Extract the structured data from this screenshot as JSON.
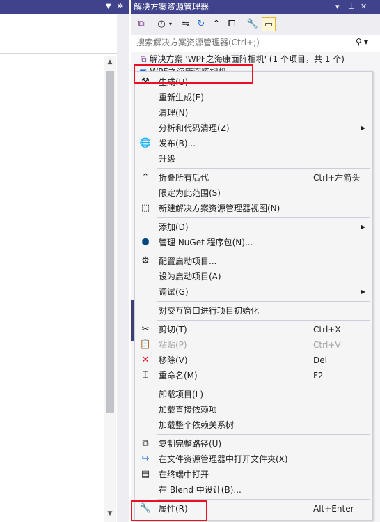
{
  "se": {
    "title": "解决方案资源管理器",
    "search_placeholder": "搜索解决方案资源管理器(Ctrl+;)",
    "solution_label": "解决方案 'WPF之海康面阵相机' (1 个项目，共 1 个)",
    "project_label": "WPF之海康面阵相机"
  },
  "menu": [
    {
      "id": "build",
      "icon": "build-icon",
      "glyph": "⚒",
      "label": "生成(U)",
      "shortcut": "",
      "submenu": false,
      "disabled": false
    },
    {
      "id": "rebuild",
      "icon": "",
      "glyph": "",
      "label": "重新生成(E)",
      "shortcut": "",
      "submenu": false,
      "disabled": false
    },
    {
      "id": "clean",
      "icon": "",
      "glyph": "",
      "label": "清理(N)",
      "shortcut": "",
      "submenu": false,
      "disabled": false
    },
    {
      "id": "analyze",
      "icon": "",
      "glyph": "",
      "label": "分析和代码清理(Z)",
      "shortcut": "",
      "submenu": true,
      "disabled": false
    },
    {
      "id": "publish",
      "icon": "globe-icon",
      "glyph": "🌐",
      "label": "发布(B)...",
      "shortcut": "",
      "submenu": false,
      "disabled": false
    },
    {
      "id": "upgrade",
      "icon": "",
      "glyph": "",
      "label": "升级",
      "shortcut": "",
      "submenu": false,
      "disabled": false
    },
    {
      "id": "collapse",
      "icon": "collapse-icon",
      "glyph": "⌃",
      "label": "折叠所有后代",
      "shortcut": "Ctrl+左箭头",
      "submenu": false,
      "disabled": false
    },
    {
      "id": "scope",
      "icon": "",
      "glyph": "",
      "label": "限定为此范围(S)",
      "shortcut": "",
      "submenu": false,
      "disabled": false
    },
    {
      "id": "newview",
      "icon": "new-view-icon",
      "glyph": "⬚",
      "label": "新建解决方案资源管理器视图(N)",
      "shortcut": "",
      "submenu": false,
      "disabled": false
    },
    {
      "id": "add",
      "icon": "",
      "glyph": "",
      "label": "添加(D)",
      "shortcut": "",
      "submenu": true,
      "disabled": false
    },
    {
      "id": "nuget",
      "icon": "nuget-icon",
      "glyph": "⬢",
      "label": "管理 NuGet 程序包(N)...",
      "shortcut": "",
      "submenu": false,
      "disabled": false
    },
    {
      "id": "startup-config",
      "icon": "gear-icon",
      "glyph": "⚙",
      "label": "配置启动项目...",
      "shortcut": "",
      "submenu": false,
      "disabled": false
    },
    {
      "id": "set-startup",
      "icon": "",
      "glyph": "",
      "label": "设为启动项目(A)",
      "shortcut": "",
      "submenu": false,
      "disabled": false
    },
    {
      "id": "debug",
      "icon": "",
      "glyph": "",
      "label": "调试(G)",
      "shortcut": "",
      "submenu": true,
      "disabled": false
    },
    {
      "id": "interactive",
      "icon": "",
      "glyph": "",
      "label": "对交互窗口进行项目初始化",
      "shortcut": "",
      "submenu": false,
      "disabled": false
    },
    {
      "id": "cut",
      "icon": "scissors-icon",
      "glyph": "✂",
      "label": "剪切(T)",
      "shortcut": "Ctrl+X",
      "submenu": false,
      "disabled": false
    },
    {
      "id": "paste",
      "icon": "paste-icon",
      "glyph": "📋",
      "label": "粘贴(P)",
      "shortcut": "Ctrl+V",
      "submenu": false,
      "disabled": true
    },
    {
      "id": "remove",
      "icon": "close-icon",
      "glyph": "✕",
      "label": "移除(V)",
      "shortcut": "Del",
      "submenu": false,
      "disabled": false
    },
    {
      "id": "rename",
      "icon": "rename-icon",
      "glyph": "⌶",
      "label": "重命名(M)",
      "shortcut": "F2",
      "submenu": false,
      "disabled": false
    },
    {
      "id": "unload",
      "icon": "",
      "glyph": "",
      "label": "卸载项目(L)",
      "shortcut": "",
      "submenu": false,
      "disabled": false
    },
    {
      "id": "load-direct",
      "icon": "",
      "glyph": "",
      "label": "加载直接依赖项",
      "shortcut": "",
      "submenu": false,
      "disabled": false
    },
    {
      "id": "load-all",
      "icon": "",
      "glyph": "",
      "label": "加载整个依赖关系树",
      "shortcut": "",
      "submenu": false,
      "disabled": false
    },
    {
      "id": "copy-path",
      "icon": "copy-icon",
      "glyph": "⧉",
      "label": "复制完整路径(U)",
      "shortcut": "",
      "submenu": false,
      "disabled": false
    },
    {
      "id": "open-folder",
      "icon": "refresh-arrow-icon",
      "glyph": "↪",
      "label": "在文件资源管理器中打开文件夹(X)",
      "shortcut": "",
      "submenu": false,
      "disabled": false
    },
    {
      "id": "terminal",
      "icon": "terminal-icon",
      "glyph": "▤",
      "label": "在终端中打开",
      "shortcut": "",
      "submenu": false,
      "disabled": false
    },
    {
      "id": "blend",
      "icon": "",
      "glyph": "",
      "label": "在 Blend 中设计(B)...",
      "shortcut": "",
      "submenu": false,
      "disabled": false
    },
    {
      "id": "properties",
      "icon": "wrench-icon",
      "glyph": "🔧",
      "label": "属性(R)",
      "shortcut": "Alt+Enter",
      "submenu": false,
      "disabled": false
    }
  ]
}
